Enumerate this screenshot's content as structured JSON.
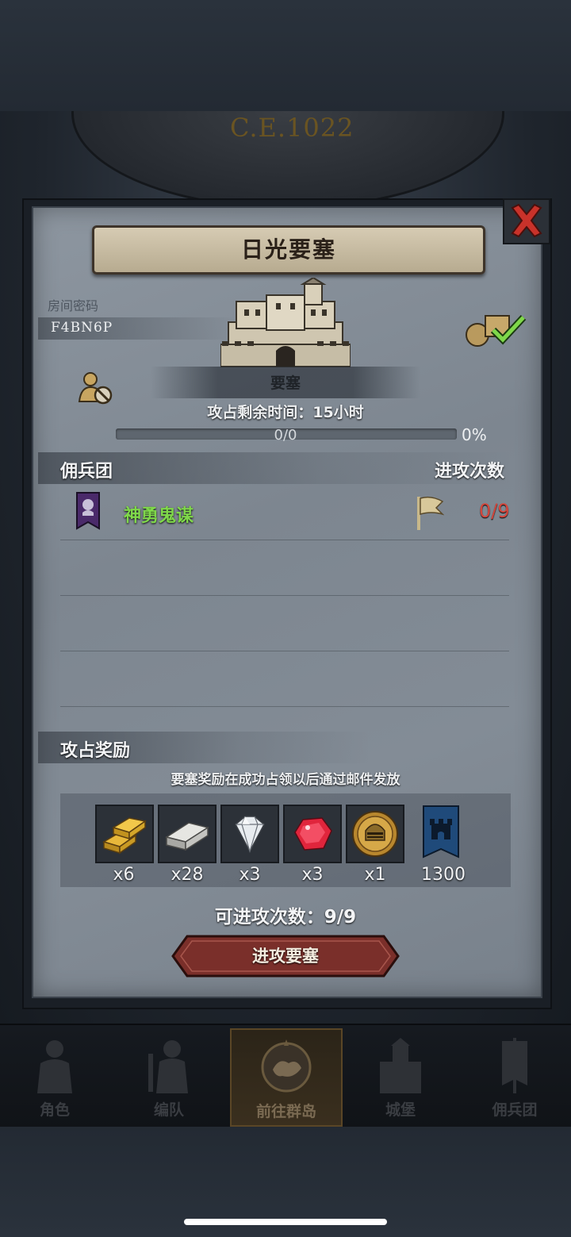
{
  "era_label": "C.E.1022",
  "dialog": {
    "title": "日光要塞",
    "room_label": "房间密码",
    "room_code": "F4BN6P",
    "fortress_label": "要塞",
    "time_remaining": "攻占剩余时间：15小时",
    "progress": {
      "text": "0/0",
      "percent_text": "0%",
      "fill_fraction": 0
    },
    "mercenary_header": "佣兵团",
    "attack_count_header": "进攻次数",
    "guilds": [
      {
        "name": "神勇鬼谋",
        "attacks": "0/9"
      }
    ],
    "reward_header": "攻占奖励",
    "reward_note": "要塞奖励在成功占领以后通过邮件发放",
    "rewards": [
      {
        "icon": "gold-bar-icon",
        "qty": "x6"
      },
      {
        "icon": "silver-bar-icon",
        "qty": "x28"
      },
      {
        "icon": "diamond-icon",
        "qty": "x3"
      },
      {
        "icon": "ruby-icon",
        "qty": "x3"
      },
      {
        "icon": "helmet-medal-icon",
        "qty": "x1"
      },
      {
        "icon": "castle-banner-icon",
        "qty": "1300"
      }
    ],
    "remaining_attacks": "可进攻次数：9/9",
    "attack_button": "进攻要塞"
  },
  "nav": [
    {
      "label": "角色",
      "icon": "knight-icon",
      "active": false
    },
    {
      "label": "编队",
      "icon": "formation-icon",
      "active": false
    },
    {
      "label": "前往群岛",
      "icon": "compass-map-icon",
      "active": true
    },
    {
      "label": "城堡",
      "icon": "castle-icon",
      "active": false
    },
    {
      "label": "佣兵团",
      "icon": "mercenary-icon",
      "active": false
    }
  ],
  "colors": {
    "guild_name": "#7fd84a",
    "attack_count": "#d4463c",
    "button": "#7a2f2a"
  }
}
